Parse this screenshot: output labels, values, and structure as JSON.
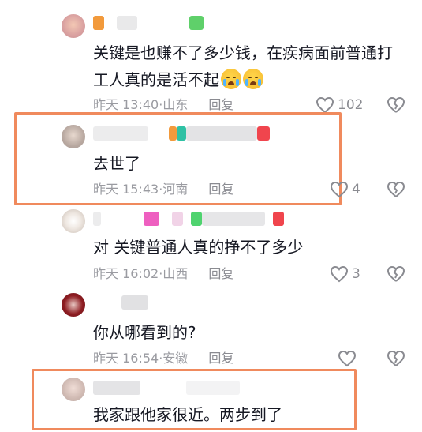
{
  "comments": [
    {
      "text": "关键是也赚不了多少钱，在疾病面前普通打",
      "text2": "工人真的是活不起",
      "time": "昨天 13:40",
      "location": "山东",
      "reply": "回复",
      "likes": "102"
    },
    {
      "text": "去世了",
      "time": "昨天 15:43",
      "location": "河南",
      "reply": "回复",
      "likes": "4"
    },
    {
      "text": "对 关键普通人真的挣不了多少",
      "time": "昨天 16:02",
      "location": "山西",
      "reply": "回复",
      "likes": "3"
    },
    {
      "text": "你从哪看到的?",
      "time": "昨天 16:54",
      "location": "安徽",
      "reply": "回复",
      "likes": ""
    },
    {
      "text": "我家跟他家很近。两步到了"
    }
  ],
  "icons": {
    "like": "heart-outline-icon",
    "dislike": "broken-heart-icon",
    "emoji": "crying-face-emoji"
  },
  "colors": {
    "highlight": "#f08a5d",
    "meta": "#9a9ba1"
  }
}
